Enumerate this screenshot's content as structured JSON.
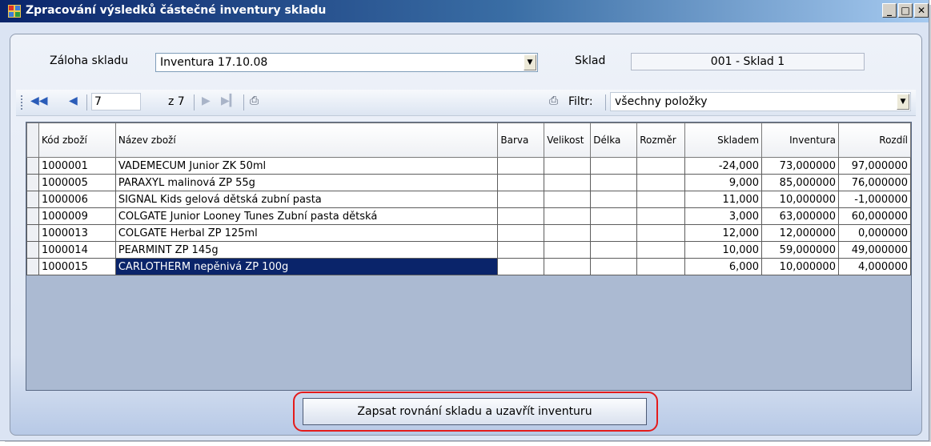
{
  "window": {
    "title": "Zpracování výsledků částečné inventury skladu",
    "min_label": "_",
    "max_label": "□",
    "close_label": "✕"
  },
  "form": {
    "zaloha_label": "Záloha skladu",
    "zaloha_value": "Inventura 17.10.08",
    "sklad_label": "Sklad",
    "sklad_value": "001 - Sklad 1"
  },
  "toolbar": {
    "position_value": "7",
    "total_label": "z 7",
    "filter_label": "Filtr:",
    "filter_value": "všechny položky"
  },
  "grid": {
    "columns": [
      "Kód zboží",
      "Název zboží",
      "Barva",
      "Velikost",
      "Délka",
      "Rozměr",
      "Skladem",
      "Inventura",
      "Rozdíl"
    ],
    "rows": [
      [
        "1000001",
        "VADEMECUM Junior ZK 50ml",
        "",
        "",
        "",
        "",
        "-24,000",
        "73,000000",
        "97,000000"
      ],
      [
        "1000005",
        "PARAXYL malinová ZP 55g",
        "",
        "",
        "",
        "",
        "9,000",
        "85,000000",
        "76,000000"
      ],
      [
        "1000006",
        "SIGNAL Kids gelová dětská zubní pasta",
        "",
        "",
        "",
        "",
        "11,000",
        "10,000000",
        "-1,000000"
      ],
      [
        "1000009",
        "COLGATE Junior Looney Tunes Zubní pasta dětská",
        "",
        "",
        "",
        "",
        "3,000",
        "63,000000",
        "60,000000"
      ],
      [
        "1000013",
        "COLGATE Herbal ZP 125ml",
        "",
        "",
        "",
        "",
        "12,000",
        "12,000000",
        "0,000000"
      ],
      [
        "1000014",
        "PEARMINT ZP 145g",
        "",
        "",
        "",
        "",
        "10,000",
        "59,000000",
        "49,000000"
      ],
      [
        "1000015",
        "CARLOTHERM nepěnivá ZP 100g",
        "",
        "",
        "",
        "",
        "6,000",
        "10,000000",
        "4,000000"
      ]
    ]
  },
  "footer": {
    "commit_button": "Zapsat rovnání skladu a uzavřít inventuru"
  },
  "colors": {
    "selection": "#0a246a",
    "highlight": "#e41b1b"
  }
}
